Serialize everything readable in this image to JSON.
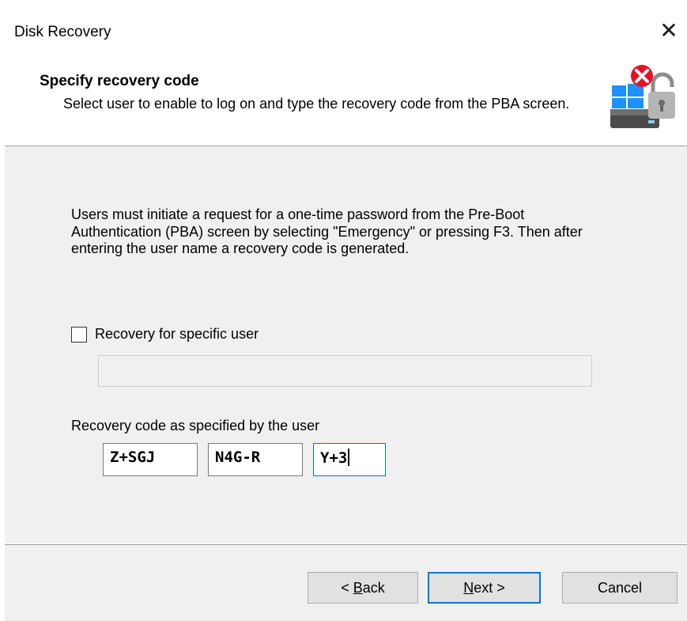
{
  "window": {
    "title": "Disk Recovery",
    "close_glyph": "✕"
  },
  "header": {
    "title": "Specify recovery code",
    "subtitle": "Select user to enable to log on and type the recovery code from the PBA screen.",
    "icon": "disk-lock-icon"
  },
  "content": {
    "intro": "Users must initiate a request for a one-time password from the Pre-Boot Authentication (PBA) screen by selecting \"Emergency\" or pressing F3. Then after entering the user name a recovery code is generated.",
    "specific_user": {
      "label": "Recovery for specific user",
      "checked": false,
      "value": ""
    },
    "code_label": "Recovery code as specified by the user",
    "codes": [
      "Z+SGJ",
      "N4G-R",
      "Y+3"
    ]
  },
  "footer": {
    "back": {
      "prefix": "< ",
      "mnemonic": "B",
      "rest": "ack"
    },
    "next": {
      "mnemonic": "N",
      "rest": "ext >"
    },
    "cancel": "Cancel"
  },
  "colors": {
    "accent": "#0078d7",
    "panel": "#f0f0f0",
    "error_red": "#e81123"
  }
}
